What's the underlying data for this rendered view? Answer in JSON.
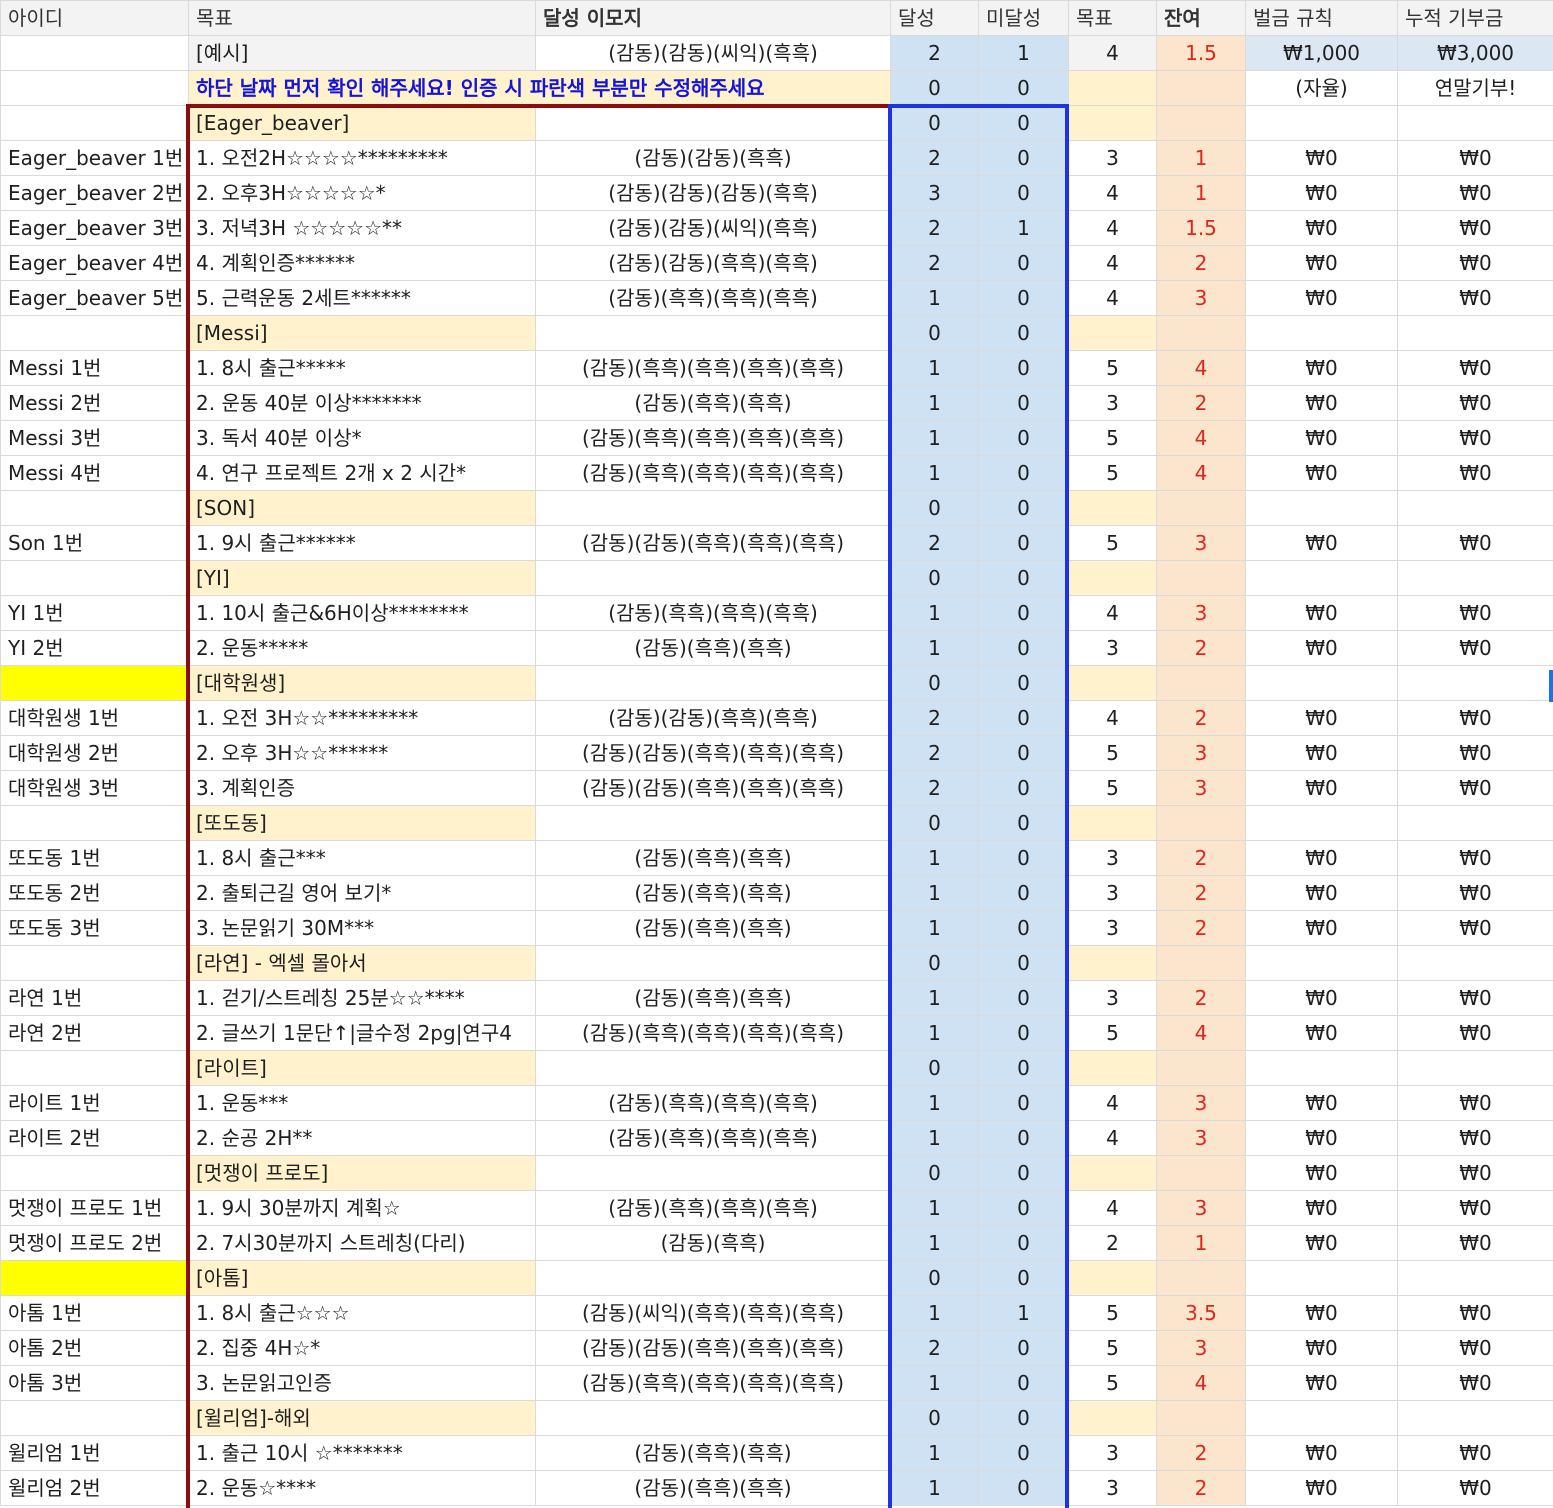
{
  "header": {
    "id": "아이디",
    "goal": "목표",
    "emoji": "달성 이모지",
    "done": "달성",
    "notdone": "미달성",
    "target": "목표",
    "remain": "잔여",
    "fine_rule": "벌금 규칙",
    "donation": "누적 기부금"
  },
  "example": {
    "goal": "[예시]",
    "emoji": "(감동)(감동)(씨익)(흑흑)",
    "done": "2",
    "notdone": "1",
    "target": "4",
    "remain": "1.5",
    "fine": "₩1,000",
    "donation": "₩3,000"
  },
  "notice": {
    "text": "하단 날짜 먼저 확인 해주세요! 인증 시 파란색 부분만 수정해주세요",
    "done": "0",
    "notdone": "0",
    "fine": "(자율)",
    "donation": "연말기부!"
  },
  "rows": [
    {
      "type": "group",
      "id": "",
      "goal": "[Eager_beaver]",
      "done": "0",
      "notdone": "0",
      "fine": "",
      "donation": "",
      "idyellow": false
    },
    {
      "type": "item",
      "id": "Eager_beaver 1번",
      "goal": "1. 오전2H☆☆☆☆*********",
      "emoji": "(감동)(감동)(흑흑)",
      "done": "2",
      "notdone": "0",
      "target": "3",
      "remain": "1",
      "fine": "₩0",
      "donation": "₩0"
    },
    {
      "type": "item",
      "id": "Eager_beaver 2번",
      "goal": "2. 오후3H☆☆☆☆☆*",
      "emoji": "(감동)(감동)(감동)(흑흑)",
      "done": "3",
      "notdone": "0",
      "target": "4",
      "remain": "1",
      "fine": "₩0",
      "donation": "₩0"
    },
    {
      "type": "item",
      "id": "Eager_beaver 3번",
      "goal": "3. 저녁3H ☆☆☆☆☆**",
      "emoji": "(감동)(감동)(씨익)(흑흑)",
      "done": "2",
      "notdone": "1",
      "target": "4",
      "remain": "1.5",
      "fine": "₩0",
      "donation": "₩0"
    },
    {
      "type": "item",
      "id": "Eager_beaver 4번",
      "goal": "4. 계획인증******",
      "emoji": "(감동)(감동)(흑흑)(흑흑)",
      "done": "2",
      "notdone": "0",
      "target": "4",
      "remain": "2",
      "fine": "₩0",
      "donation": "₩0"
    },
    {
      "type": "item",
      "id": "Eager_beaver 5번",
      "goal": "5. 근력운동 2세트******",
      "emoji": "(감동)(흑흑)(흑흑)(흑흑)",
      "done": "1",
      "notdone": "0",
      "target": "4",
      "remain": "3",
      "fine": "₩0",
      "donation": "₩0"
    },
    {
      "type": "group",
      "id": "",
      "goal": "[Messi]",
      "done": "0",
      "notdone": "0",
      "fine": "",
      "donation": "",
      "idyellow": false
    },
    {
      "type": "item",
      "id": "Messi 1번",
      "goal": "1. 8시 출근*****",
      "emoji": "(감동)(흑흑)(흑흑)(흑흑)(흑흑)",
      "done": "1",
      "notdone": "0",
      "target": "5",
      "remain": "4",
      "fine": "₩0",
      "donation": "₩0"
    },
    {
      "type": "item",
      "id": "Messi 2번",
      "goal": "2. 운동 40분 이상*******",
      "emoji": "(감동)(흑흑)(흑흑)",
      "done": "1",
      "notdone": "0",
      "target": "3",
      "remain": "2",
      "fine": "₩0",
      "donation": "₩0"
    },
    {
      "type": "item",
      "id": "Messi 3번",
      "goal": "3. 독서 40분 이상*",
      "emoji": "(감동)(흑흑)(흑흑)(흑흑)(흑흑)",
      "done": "1",
      "notdone": "0",
      "target": "5",
      "remain": "4",
      "fine": "₩0",
      "donation": "₩0"
    },
    {
      "type": "item",
      "id": "Messi 4번",
      "goal": "4. 연구 프로젝트 2개 x 2 시간*",
      "emoji": "(감동)(흑흑)(흑흑)(흑흑)(흑흑)",
      "done": "1",
      "notdone": "0",
      "target": "5",
      "remain": "4",
      "fine": "₩0",
      "donation": "₩0"
    },
    {
      "type": "group",
      "id": "",
      "goal": "[SON]",
      "done": "0",
      "notdone": "0",
      "fine": "",
      "donation": "",
      "idyellow": false
    },
    {
      "type": "item",
      "id": "Son 1번",
      "goal": "1. 9시 출근******",
      "emoji": "(감동)(감동)(흑흑)(흑흑)(흑흑)",
      "done": "2",
      "notdone": "0",
      "target": "5",
      "remain": "3",
      "fine": "₩0",
      "donation": "₩0"
    },
    {
      "type": "group",
      "id": "",
      "goal": "[YI]",
      "done": "0",
      "notdone": "0",
      "fine": "",
      "donation": "",
      "idyellow": false
    },
    {
      "type": "item",
      "id": "YI 1번",
      "goal": "1. 10시 출근&6H이상********",
      "emoji": "(감동)(흑흑)(흑흑)(흑흑)",
      "done": "1",
      "notdone": "0",
      "target": "4",
      "remain": "3",
      "fine": "₩0",
      "donation": "₩0"
    },
    {
      "type": "item",
      "id": "YI 2번",
      "goal": "2. 운동*****",
      "emoji": "(감동)(흑흑)(흑흑)",
      "done": "1",
      "notdone": "0",
      "target": "3",
      "remain": "2",
      "fine": "₩0",
      "donation": "₩0"
    },
    {
      "type": "group",
      "id": "",
      "goal": "[대학원생]",
      "done": "0",
      "notdone": "0",
      "fine": "",
      "donation": "",
      "idyellow": true
    },
    {
      "type": "item",
      "id": "대학원생 1번",
      "goal": "1. 오전 3H☆☆*********",
      "emoji": "(감동)(감동)(흑흑)(흑흑)",
      "done": "2",
      "notdone": "0",
      "target": "4",
      "remain": "2",
      "fine": "₩0",
      "donation": "₩0"
    },
    {
      "type": "item",
      "id": "대학원생 2번",
      "goal": "2. 오후 3H☆☆******",
      "emoji": "(감동)(감동)(흑흑)(흑흑)(흑흑)",
      "done": "2",
      "notdone": "0",
      "target": "5",
      "remain": "3",
      "fine": "₩0",
      "donation": "₩0"
    },
    {
      "type": "item",
      "id": "대학원생 3번",
      "goal": "3. 계획인증",
      "emoji": "(감동)(감동)(흑흑)(흑흑)(흑흑)",
      "done": "2",
      "notdone": "0",
      "target": "5",
      "remain": "3",
      "fine": "₩0",
      "donation": "₩0"
    },
    {
      "type": "group",
      "id": "",
      "goal": "[또도동]",
      "done": "0",
      "notdone": "0",
      "fine": "",
      "donation": "",
      "idyellow": false
    },
    {
      "type": "item",
      "id": "또도동 1번",
      "goal": "1. 8시 출근***",
      "emoji": "(감동)(흑흑)(흑흑)",
      "done": "1",
      "notdone": "0",
      "target": "3",
      "remain": "2",
      "fine": "₩0",
      "donation": "₩0"
    },
    {
      "type": "item",
      "id": "또도동 2번",
      "goal": "2. 출퇴근길 영어 보기*",
      "emoji": "(감동)(흑흑)(흑흑)",
      "done": "1",
      "notdone": "0",
      "target": "3",
      "remain": "2",
      "fine": "₩0",
      "donation": "₩0"
    },
    {
      "type": "item",
      "id": "또도동 3번",
      "goal": "3. 논문읽기 30M***",
      "emoji": "(감동)(흑흑)(흑흑)",
      "done": "1",
      "notdone": "0",
      "target": "3",
      "remain": "2",
      "fine": "₩0",
      "donation": "₩0"
    },
    {
      "type": "group",
      "id": "",
      "goal": "[라연] - 엑셀 몰아서",
      "done": "0",
      "notdone": "0",
      "fine": "",
      "donation": "",
      "idyellow": false
    },
    {
      "type": "item",
      "id": "라연 1번",
      "goal": "1. 걷기/스트레칭 25분☆☆****",
      "emoji": "(감동)(흑흑)(흑흑)",
      "done": "1",
      "notdone": "0",
      "target": "3",
      "remain": "2",
      "fine": "₩0",
      "donation": "₩0"
    },
    {
      "type": "item",
      "id": "라연 2번",
      "goal": "2. 글쓰기 1문단↑|글수정 2pg|연구4",
      "emoji": "(감동)(흑흑)(흑흑)(흑흑)(흑흑)",
      "done": "1",
      "notdone": "0",
      "target": "5",
      "remain": "4",
      "fine": "₩0",
      "donation": "₩0"
    },
    {
      "type": "group",
      "id": "",
      "goal": "[라이트]",
      "done": "0",
      "notdone": "0",
      "fine": "",
      "donation": "",
      "idyellow": false
    },
    {
      "type": "item",
      "id": "라이트 1번",
      "goal": "1. 운동***",
      "emoji": "(감동)(흑흑)(흑흑)(흑흑)",
      "done": "1",
      "notdone": "0",
      "target": "4",
      "remain": "3",
      "fine": "₩0",
      "donation": "₩0"
    },
    {
      "type": "item",
      "id": "라이트 2번",
      "goal": "2. 순공 2H**",
      "emoji": "(감동)(흑흑)(흑흑)(흑흑)",
      "done": "1",
      "notdone": "0",
      "target": "4",
      "remain": "3",
      "fine": "₩0",
      "donation": "₩0"
    },
    {
      "type": "group",
      "id": "",
      "goal": "[멋쟁이 프로도]",
      "done": "0",
      "notdone": "0",
      "fine": "₩0",
      "donation": "₩0",
      "idyellow": false
    },
    {
      "type": "item",
      "id": "멋쟁이 프로도 1번",
      "goal": "1. 9시 30분까지 계획☆",
      "emoji": "(감동)(흑흑)(흑흑)(흑흑)",
      "done": "1",
      "notdone": "0",
      "target": "4",
      "remain": "3",
      "fine": "₩0",
      "donation": "₩0"
    },
    {
      "type": "item",
      "id": "멋쟁이 프로도 2번",
      "goal": "2. 7시30분까지 스트레칭(다리)",
      "emoji": "(감동)(흑흑)",
      "done": "1",
      "notdone": "0",
      "target": "2",
      "remain": "1",
      "fine": "₩0",
      "donation": "₩0"
    },
    {
      "type": "group",
      "id": "",
      "goal": "[아톰]",
      "done": "0",
      "notdone": "0",
      "fine": "",
      "donation": "",
      "idyellow": true
    },
    {
      "type": "item",
      "id": "아톰 1번",
      "goal": "1. 8시 출근☆☆☆",
      "emoji": "(감동)(씨익)(흑흑)(흑흑)(흑흑)",
      "done": "1",
      "notdone": "1",
      "target": "5",
      "remain": "3.5",
      "fine": "₩0",
      "donation": "₩0"
    },
    {
      "type": "item",
      "id": "아톰 2번",
      "goal": "2. 집중 4H☆*",
      "emoji": "(감동)(감동)(흑흑)(흑흑)(흑흑)",
      "done": "2",
      "notdone": "0",
      "target": "5",
      "remain": "3",
      "fine": "₩0",
      "donation": "₩0"
    },
    {
      "type": "item",
      "id": "아톰 3번",
      "goal": "3. 논문읽고인증",
      "emoji": "(감동)(흑흑)(흑흑)(흑흑)(흑흑)",
      "done": "1",
      "notdone": "0",
      "target": "5",
      "remain": "4",
      "fine": "₩0",
      "donation": "₩0"
    },
    {
      "type": "group",
      "id": "",
      "goal": "[윌리엄]-해외",
      "done": "0",
      "notdone": "0",
      "fine": "",
      "donation": "",
      "idyellow": false
    },
    {
      "type": "item",
      "id": "윌리엄 1번",
      "goal": "1. 출근 10시 ☆*******",
      "emoji": "(감동)(흑흑)(흑흑)",
      "done": "1",
      "notdone": "0",
      "target": "3",
      "remain": "2",
      "fine": "₩0",
      "donation": "₩0"
    },
    {
      "type": "item",
      "id": "윌리엄 2번",
      "goal": "2. 운동☆****",
      "emoji": "(감동)(흑흑)(흑흑)",
      "done": "1",
      "notdone": "0",
      "target": "3",
      "remain": "2",
      "fine": "₩0",
      "donation": "₩0"
    }
  ]
}
